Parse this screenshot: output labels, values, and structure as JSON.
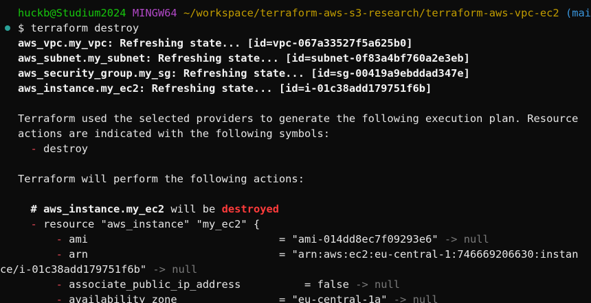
{
  "prompt": {
    "user_host": "huckb@Studium2024",
    "shell": "MINGW64",
    "path": "~/workspace/terraform-aws-s3-research/terraform-aws-vpc-ec2",
    "branch": "(main)",
    "symbol": "$",
    "command": "terraform destroy"
  },
  "refresh_lines": [
    "aws_vpc.my_vpc: Refreshing state... [id=vpc-067a33527f5a625b0]",
    "aws_subnet.my_subnet: Refreshing state... [id=subnet-0f83a4bf760a2e3eb]",
    "aws_security_group.my_sg: Refreshing state... [id=sg-00419a9ebddad347e]",
    "aws_instance.my_ec2: Refreshing state... [id=i-01c38add179751f6b]"
  ],
  "plan_intro": {
    "line1": "Terraform used the selected providers to generate the following execution plan. Resource",
    "line2": "actions are indicated with the following symbols:",
    "symbol_dash": "-",
    "symbol_label": "destroy"
  },
  "perform_line": "Terraform will perform the following actions:",
  "resource_header": {
    "hash": "#",
    "address": "aws_instance.my_ec2",
    "will_be": "will be",
    "action": "destroyed"
  },
  "resource_decl": {
    "dash": "-",
    "text": "resource \"aws_instance\" \"my_ec2\" {"
  },
  "attributes": [
    {
      "name": "ami",
      "value": "= \"ami-014dd8ec7f09293e6\"",
      "arrow": "-> null"
    },
    {
      "name": "arn",
      "value": "= \"arn:aws:ec2:eu-central-1:746669206630:instan"
    },
    {
      "continuation": "ce/i-01c38add179751f6b\"",
      "arrow": "-> null"
    },
    {
      "name": "associate_public_ip_address",
      "value": "= false",
      "arrow": "-> null"
    },
    {
      "name": "availability_zone",
      "value": "= \"eu-central-1a\"",
      "arrow": "-> null"
    }
  ],
  "colors": {
    "background": "#0c0c0c",
    "user_host": "#16c60c",
    "shell": "#b148c6",
    "path": "#c19c00",
    "branch": "#3a96dd",
    "destroy": "#e74856",
    "null_arrow": "#7a7a7a",
    "marker": "#2aa198"
  }
}
